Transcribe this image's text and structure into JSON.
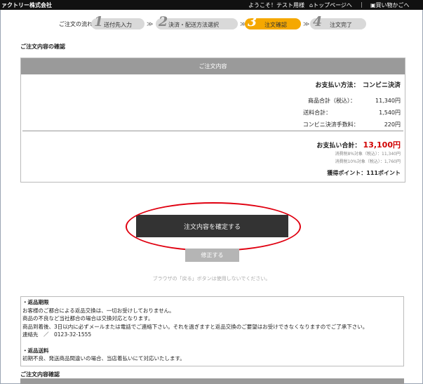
{
  "header": {
    "company": "ァクトリー株式会社",
    "welcome": "ようこそ！テスト用様",
    "top_link": "⌂トップページへ",
    "separator": "|",
    "continue_link": "▣買い物かごへ"
  },
  "steps": {
    "label": "ご注文の流れ：",
    "separator": "≫",
    "items": [
      {
        "num": "1",
        "label": "送付先入力"
      },
      {
        "num": "2",
        "label": "決済・配送方法選択"
      },
      {
        "num": "3",
        "label": "注文確認"
      },
      {
        "num": "4",
        "label": "注文完了"
      }
    ]
  },
  "page_title": "ご注文内容の確認",
  "summary": {
    "header": "ご注文内容",
    "payment_method": "お支払い方法：　コンビニ決済",
    "rows": [
      "商品合計（税込）：　　　　11,340円",
      "送料合計：　　　　　　　　　1,540円",
      "コンビニ決済手数料：　　　　　220円"
    ],
    "total_label": "お支払い合計：",
    "total_value": "13,100円",
    "tax_lines": [
      "消費税8%対象（税込）：11,340円",
      "消費税10%対象（税込）：1,760円"
    ],
    "points": "獲得ポイント：111ポイント"
  },
  "buttons": {
    "confirm": "注文内容を確定する",
    "edit": "修正する"
  },
  "notice": "ブラウザの「戻る」ボタンは使用しないでください。",
  "policy": {
    "return_period_title": "・返品期限",
    "return_period_lines": [
      "お客様のご都合による返品交換は、一切お受けしておりません。",
      "商品の不良など当社都合の場合は交換対応となります。",
      "商品到着後、3日以内に必ずメールまたは電話でご連絡下さい。それを過ぎますと返品交換のご要望はお受けできなくなりますのでご了承下さい。",
      "連絡先　／　0123-32-1555"
    ],
    "shipping_title": "・返品送料",
    "shipping_lines": [
      "初期不良、発送商品間違いの場合、当店着払いにて対応いたします。"
    ]
  },
  "bottom_title": "ご注文内容確認"
}
